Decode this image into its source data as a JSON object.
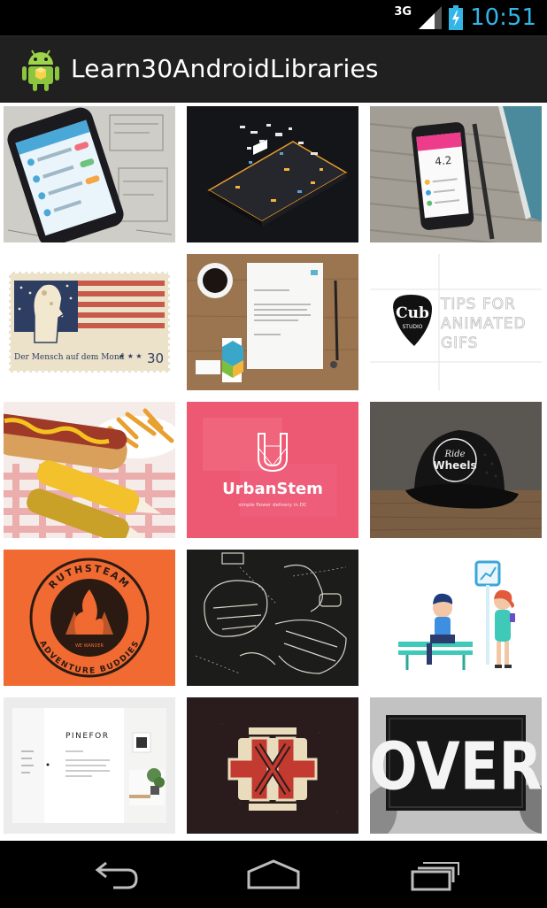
{
  "status_bar": {
    "network": "3G",
    "time": "10:51"
  },
  "action_bar": {
    "title": "Learn30AndroidLibraries"
  },
  "gallery": {
    "tiles": [
      {
        "name": "tile-phone-sketch"
      },
      {
        "name": "tile-circuit-board"
      },
      {
        "name": "tile-phone-notebook"
      },
      {
        "name": "tile-moon-stamp",
        "caption": "Der Mensch auf dem Mond",
        "value": "30",
        "stars": "★ ★ ★"
      },
      {
        "name": "tile-stationery"
      },
      {
        "name": "tile-cub-studio",
        "logo_line1": "Cub",
        "logo_line2": "STUDIO",
        "text_lines": [
          "TIPS FOR",
          "ANIMATED",
          "GIFS"
        ]
      },
      {
        "name": "tile-hotdog"
      },
      {
        "name": "tile-urbanstem",
        "brand": "UrbanStem",
        "tagline": "simple flower delivery in DC"
      },
      {
        "name": "tile-ride-wheels-cap",
        "line1": "Ride",
        "line2": "Wheels"
      },
      {
        "name": "tile-ruthsteam-badge",
        "top_text": "RUTHSTEAM",
        "bottom_text": "ADVENTURE BUDDIES",
        "center_text": "WE WANDER"
      },
      {
        "name": "tile-helmet-sketch"
      },
      {
        "name": "tile-bench-characters"
      },
      {
        "name": "tile-pinefor",
        "brand": "PINEFOR"
      },
      {
        "name": "tile-monogram"
      },
      {
        "name": "tile-over-sign",
        "word": "OVER"
      }
    ]
  }
}
